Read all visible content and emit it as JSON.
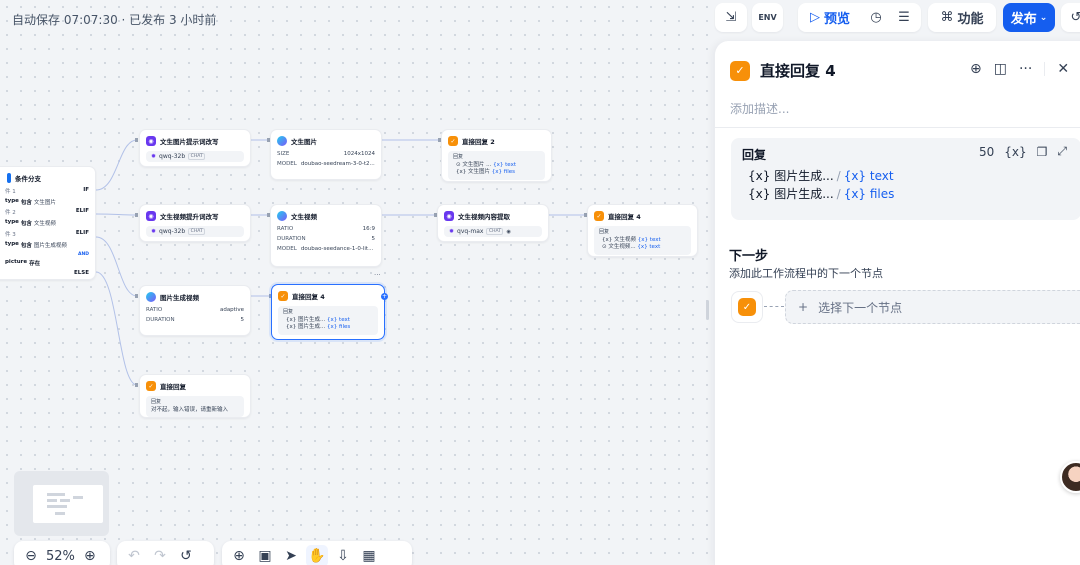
{
  "status": {
    "autosave": "自动保存 07:07:30 · 已发布 3 小时前"
  },
  "toolbar": {
    "preview": "预览",
    "features": "功能",
    "publish": "发布"
  },
  "nodes": {
    "condition": {
      "title": "条件分支",
      "case1_label": "件 1",
      "case1_tag": "IF",
      "case1_var": "type",
      "case1_op": "包含",
      "case1_val": "文生图片",
      "case2_label": "件 2",
      "case2_tag": "ELIF",
      "case2_var": "type",
      "case2_op": "包含",
      "case2_val": "文生视频",
      "case3_label": "件 3",
      "case3_tag": "ELIF",
      "case3_var": "type",
      "case3_op": "包含",
      "case3_val": "图片生成视频",
      "and": "AND",
      "case3_var2": "picture",
      "case3_op2": "存在",
      "else": "ELSE"
    },
    "t2i_prompt": {
      "title": "文生图片提示词改写",
      "model": "qwq-32b",
      "mode": "CHAT"
    },
    "t2i": {
      "title": "文生图片",
      "size_k": "SIZE",
      "size_v": "1024x1024",
      "model_k": "MODEL",
      "model_v": "doubao-seedream-3-0-t2..."
    },
    "reply2": {
      "title": "直接回复 2",
      "label": "回复",
      "l1a": "文生图片 ...",
      "l1b": "text",
      "l2a": "文生图片",
      "l2b": "files"
    },
    "t2v_prompt": {
      "title": "文生视频提升词改写",
      "model": "qwq-32b",
      "mode": "CHAT"
    },
    "t2v": {
      "title": "文生视频",
      "ratio_k": "RATIO",
      "ratio_v": "16:9",
      "dur_k": "DURATION",
      "dur_v": "5",
      "model_k": "MODEL",
      "model_v": "doubao-seedance-1-0-lit..."
    },
    "t2v_extract": {
      "title": "文生视频内容提取",
      "model": "qvq-max",
      "mode": "CHAT"
    },
    "reply4b": {
      "title": "直接回复 4",
      "label": "回复",
      "l1a": "文生视频",
      "l1b": "text",
      "l2a": "文生视频...",
      "l2b": "text"
    },
    "i2v": {
      "title": "图片生成视频",
      "ratio_k": "RATIO",
      "ratio_v": "adaptive",
      "dur_k": "DURATION",
      "dur_v": "5"
    },
    "reply4": {
      "title": "直接回复 4",
      "label": "回复",
      "l1a": "图片生成...",
      "l1b": "text",
      "l2a": "图片生成...",
      "l2b": "files"
    },
    "reply_default": {
      "title": "直接回复",
      "label": "回复",
      "text": "对不起，输入错误，请重新输入"
    }
  },
  "zoom": {
    "value": "52%"
  },
  "panel": {
    "title": "直接回复 4",
    "desc_placeholder": "添加描述...",
    "reply_label": "回复",
    "count": "50",
    "var_icon": "{x}",
    "line1_src": "图片生成...",
    "line1_var": "text",
    "line2_src": "图片生成...",
    "line2_var": "files",
    "next_title": "下一步",
    "next_desc": "添加此工作流程中的下一个节点",
    "select_next": "选择下一个节点"
  },
  "colors": {
    "accent": "#155eef",
    "reply_icon": "#f79009",
    "llm_icon": "#6938ef"
  }
}
